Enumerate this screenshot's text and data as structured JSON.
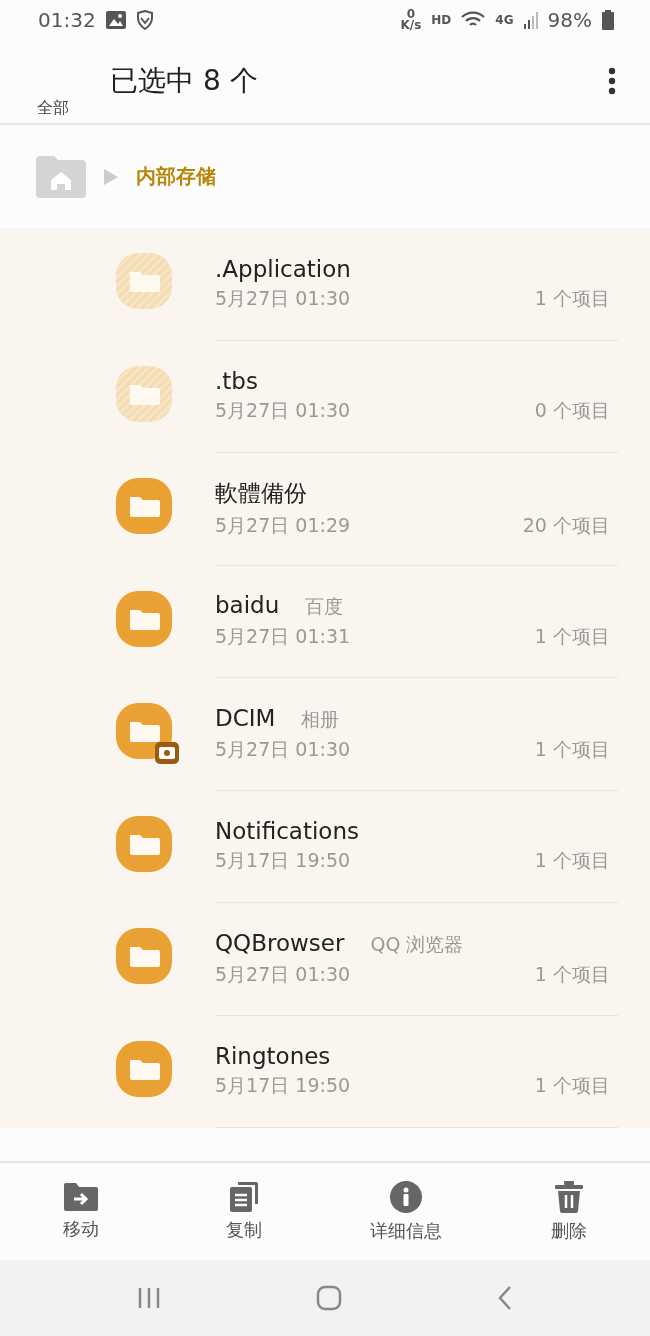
{
  "status_bar": {
    "time": "01:32",
    "speed_value": "0",
    "speed_unit": "K/s",
    "hd": "HD",
    "network": "4G",
    "battery": "98%"
  },
  "header": {
    "title": "已选中 8 个",
    "select_all": "全部"
  },
  "breadcrumb": {
    "path": "内部存储"
  },
  "folders": [
    {
      "name": ".Application",
      "date": "5月27日 01:30",
      "count": "1 个项目",
      "kind": "hidden",
      "selected": true
    },
    {
      "name": ".tbs",
      "date": "5月27日 01:30",
      "count": "0 个项目",
      "kind": "hidden",
      "selected": true
    },
    {
      "name": "軟體備份",
      "date": "5月27日 01:29",
      "count": "20 个项目",
      "kind": "normal",
      "selected": true
    },
    {
      "name": "baidu",
      "alias": "百度",
      "date": "5月27日 01:31",
      "count": "1 个项目",
      "kind": "normal",
      "selected": true
    },
    {
      "name": "DCIM",
      "alias": "相册",
      "date": "5月27日 01:30",
      "count": "1 个项目",
      "kind": "camera",
      "selected": true
    },
    {
      "name": "Notifications",
      "date": "5月17日 19:50",
      "count": "1 个项目",
      "kind": "normal",
      "selected": true
    },
    {
      "name": "QQBrowser",
      "alias": "QQ 浏览器",
      "date": "5月27日 01:30",
      "count": "1 个项目",
      "kind": "normal",
      "selected": true
    },
    {
      "name": "Ringtones",
      "date": "5月17日 19:50",
      "count": "1 个项目",
      "kind": "normal",
      "selected": true
    }
  ],
  "actions": [
    {
      "label": "移动",
      "kind": "move"
    },
    {
      "label": "复制",
      "kind": "copy"
    },
    {
      "label": "详细信息",
      "kind": "info"
    },
    {
      "label": "删除",
      "kind": "delete"
    }
  ]
}
